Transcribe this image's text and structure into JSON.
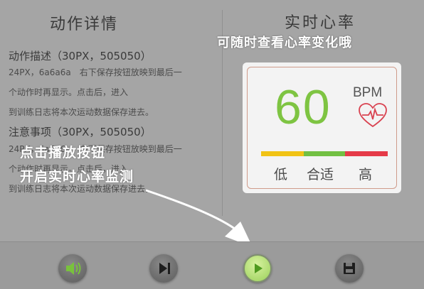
{
  "left_panel": {
    "title": "动作详情",
    "section1_heading": "动作描述（30PX，505050）",
    "section1_lines": [
      "24PX，6a6a6a　右下保存按钮放映到最后一",
      "个动作时再显示。点击后，进入",
      "到训练日志将本次运动数据保存进去。"
    ],
    "section2_heading": "注意事项（30PX，505050）",
    "section2_lines": [
      "24PX，6a6a6a　右下保存按钮放映到最后一",
      "个动作时再显示。点击后，进入",
      "到训练日志将本次运动数据保存进去。"
    ]
  },
  "right_panel": {
    "title": "实时心率",
    "tip": "可随时查看心率变化哦",
    "heart_rate_value": "60",
    "unit": "BPM",
    "levels": [
      "低",
      "合适",
      "高"
    ],
    "colors": {
      "low": "#f1c315",
      "ok": "#72c043",
      "high": "#e53a48",
      "value": "#7ec442"
    }
  },
  "overlay_tip": {
    "line1": "点击播放按钮",
    "line2": "开启实时心率监测"
  },
  "controls": [
    {
      "name": "volume-button",
      "icon": "speaker-icon"
    },
    {
      "name": "next-button",
      "icon": "skip-next-icon"
    },
    {
      "name": "play-button",
      "icon": "play-icon"
    },
    {
      "name": "save-button",
      "icon": "save-icon"
    }
  ]
}
